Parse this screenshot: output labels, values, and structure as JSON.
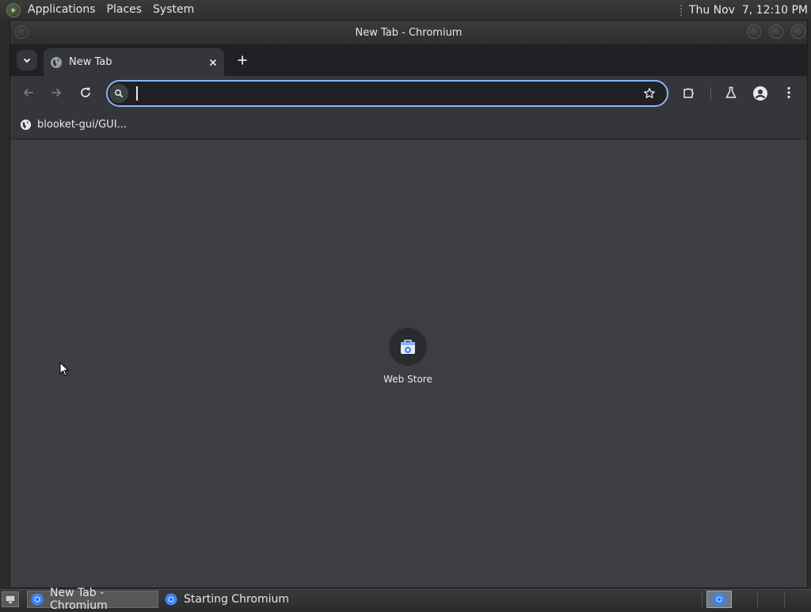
{
  "top_panel": {
    "menus": [
      "Applications",
      "Places",
      "System"
    ],
    "clock": "Thu Nov  7, 12:10 PM"
  },
  "window": {
    "title": "New Tab - Chromium"
  },
  "tabs": [
    {
      "label": "New Tab",
      "active": true
    }
  ],
  "omnibox": {
    "value": "",
    "placeholder": ""
  },
  "bookmarks": [
    {
      "label": "blooket-gui/GUI..."
    }
  ],
  "content": {
    "shortcuts": [
      {
        "label": "Web Store",
        "icon": "web-store-icon"
      }
    ]
  },
  "taskbar": {
    "tasks": [
      {
        "label": "New Tab - Chromium",
        "active": true
      },
      {
        "label": "Starting Chromium",
        "active": false
      }
    ]
  },
  "colors": {
    "accent": "#8ab4f8",
    "tabstrip_bg": "#202124",
    "toolbar_bg": "#35363a",
    "content_bg": "#3d3d42"
  }
}
